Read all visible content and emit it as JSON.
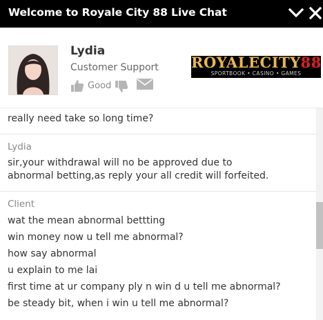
{
  "window": {
    "title": "Welcome to Royale City 88 Live Chat",
    "minimize_icon": "chevron-down-icon",
    "close_icon": "close-icon",
    "bar_color": "#000000"
  },
  "agent": {
    "name": "Lydia",
    "role": "Customer Support",
    "rating_label": "Good",
    "icons": [
      "thumbs-up-icon",
      "thumbs-down-icon",
      "email-icon"
    ],
    "logo": {
      "wordmark": "ROYALECITY88",
      "tagline": "SPORTBOOK • CASINO • GAMES"
    }
  },
  "messages": [
    {
      "sender": "",
      "lines": [
        "really need take so long time?"
      ]
    },
    {
      "sender": "Lydia",
      "lines": [
        "sir,your withdrawal will no be approved due to",
        "abnormal betting,as reply your all credit will forfeited."
      ]
    },
    {
      "sender": "Client",
      "lines": [
        "wat the mean abnormal bettting",
        "win money now u tell me abnormal?",
        "how say abnormal",
        "u explain to me lai",
        "first time at ur company ply n win d u tell me abnormal?",
        "be steady bit, when i win u tell me abnormal?"
      ]
    }
  ]
}
